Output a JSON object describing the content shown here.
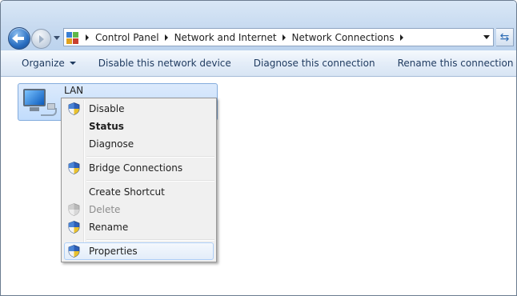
{
  "breadcrumb": [
    "Control Panel",
    "Network and Internet",
    "Network Connections"
  ],
  "toolbar": {
    "organize": "Organize",
    "disable": "Disable this network device",
    "diagnose": "Diagnose this connection",
    "rename": "Rename this connection",
    "more": "»"
  },
  "connection": {
    "name": "LAN"
  },
  "context_menu": {
    "items": [
      {
        "label": "Disable",
        "icon": "uac-shield-icon",
        "enabled": true
      },
      {
        "label": "Status",
        "icon": null,
        "default": true
      },
      {
        "label": "Diagnose",
        "icon": null
      },
      {
        "label": "Bridge Connections",
        "icon": "uac-shield-icon"
      },
      {
        "label": "Create Shortcut",
        "icon": null
      },
      {
        "label": "Delete",
        "icon": "uac-shield-icon",
        "enabled": false
      },
      {
        "label": "Rename",
        "icon": "uac-shield-icon"
      },
      {
        "label": "Properties",
        "icon": "uac-shield-icon",
        "highlighted": true
      }
    ]
  },
  "colors": {
    "selection": "#c1dcfc",
    "menu_bg": "#f0f0f0",
    "toolbar_text": "#1e3a5f"
  }
}
